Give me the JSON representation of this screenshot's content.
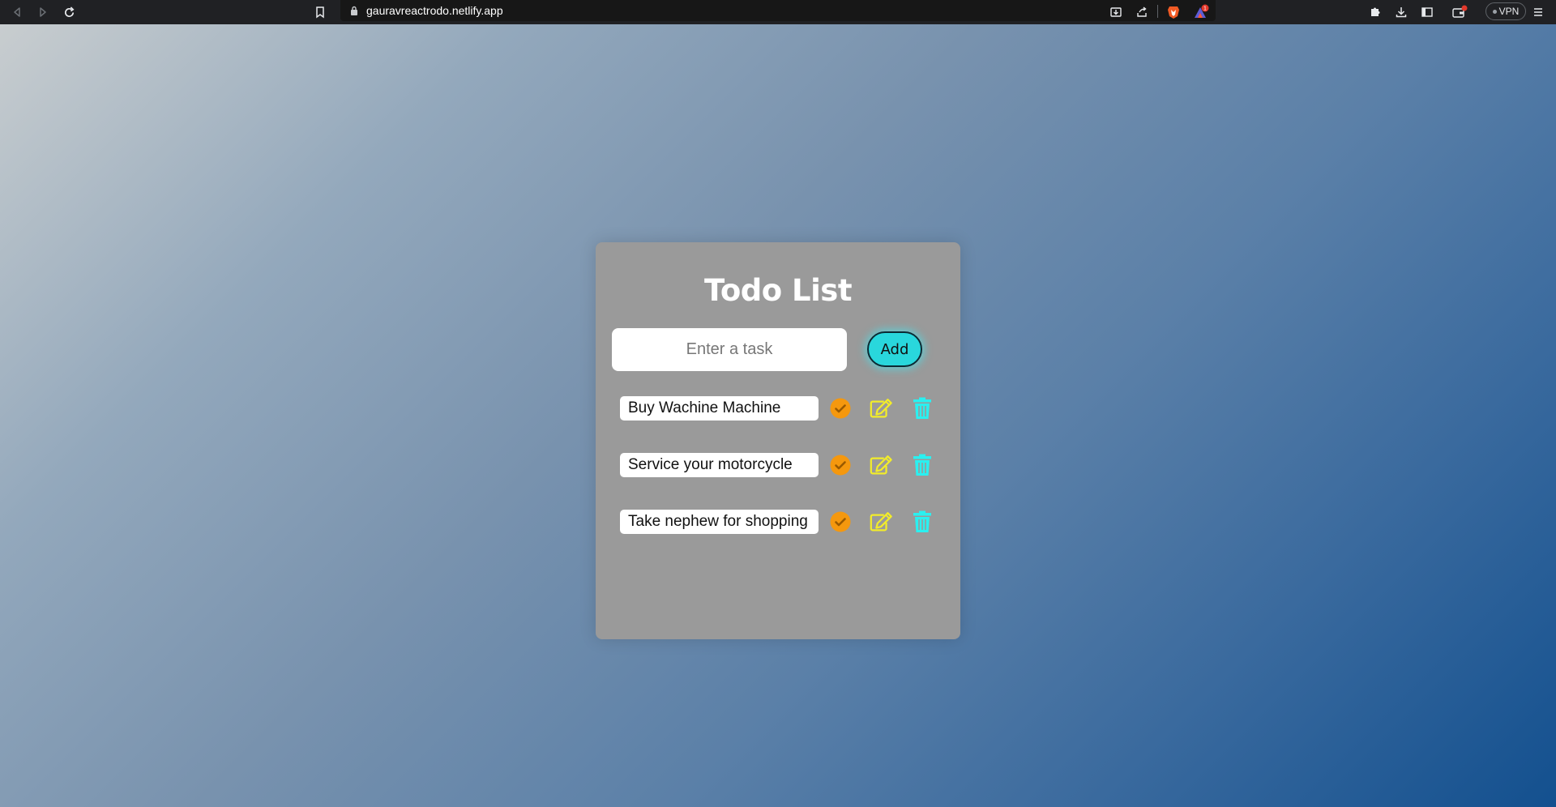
{
  "browser": {
    "url": "gauravreactrodo.netlify.app",
    "vpn_label": "VPN",
    "notification_count": "1"
  },
  "app": {
    "title": "Todo List",
    "input_placeholder": "Enter a task",
    "add_label": "Add",
    "todos": [
      {
        "text": "Buy Wachine Machine"
      },
      {
        "text": "Service your motorcycle"
      },
      {
        "text": "Take nephew for shopping"
      }
    ]
  },
  "colors": {
    "complete_icon": "#f5980e",
    "edit_icon": "#f2ec2a",
    "delete_icon": "#2af0f0",
    "add_button": "#29d7dc"
  }
}
